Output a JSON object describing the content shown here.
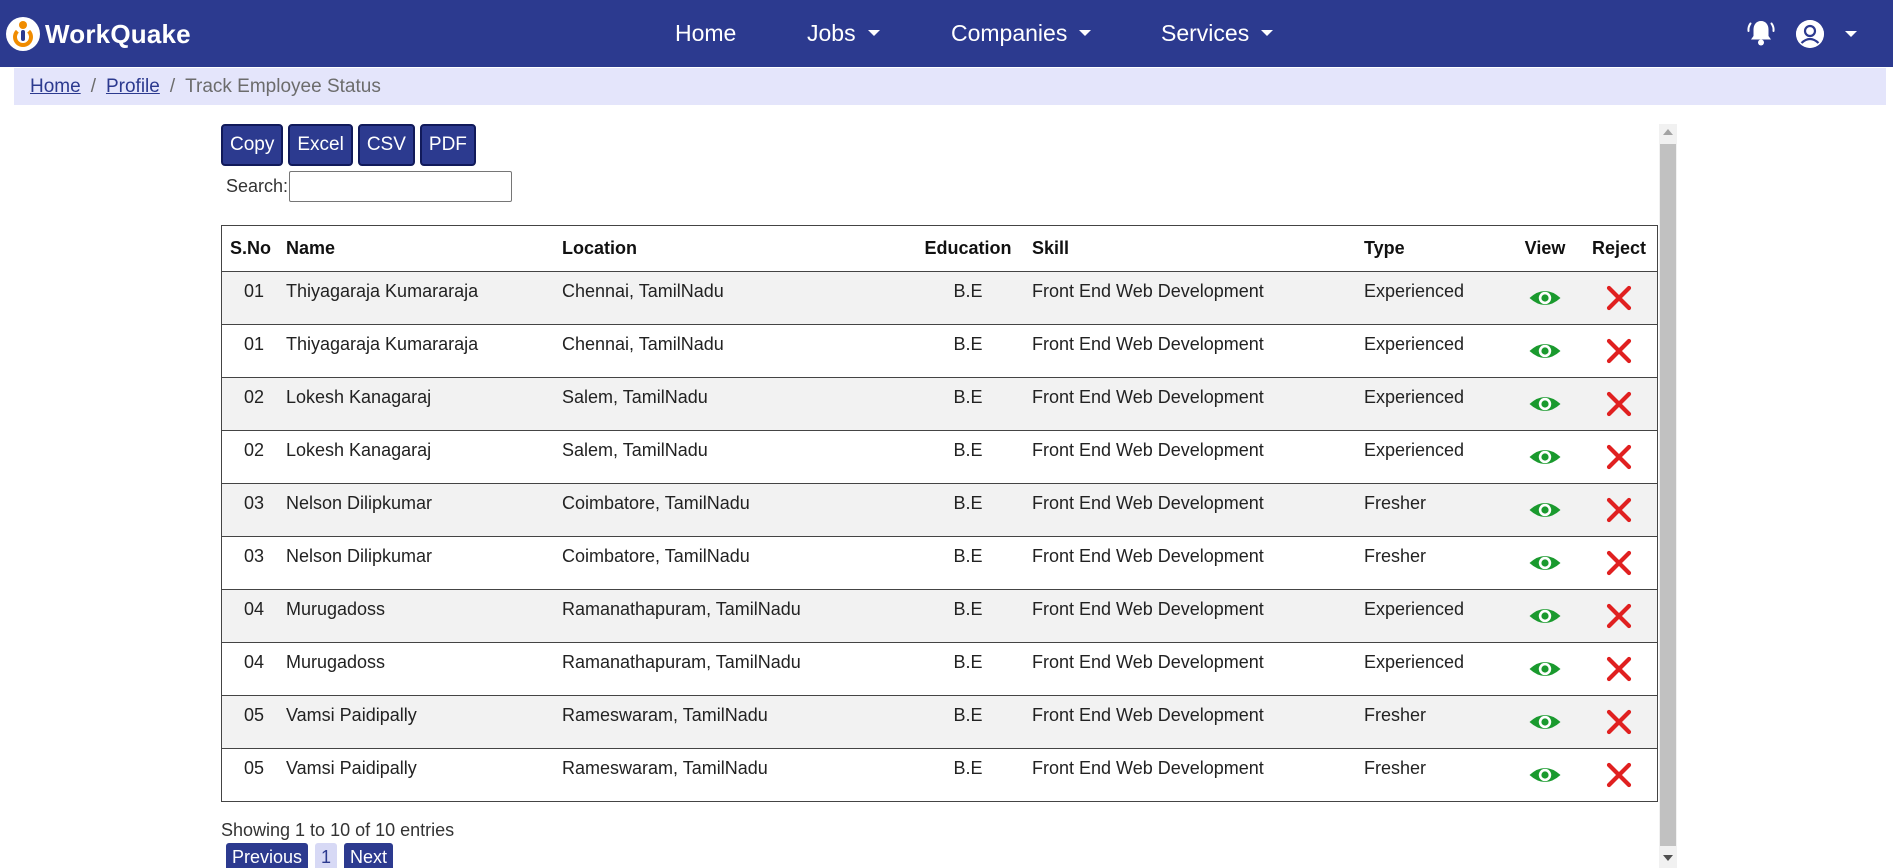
{
  "nav": {
    "brand": "WorkQuake",
    "items": [
      {
        "label": "Home"
      },
      {
        "label": "Jobs"
      },
      {
        "label": "Companies"
      },
      {
        "label": "Services"
      }
    ]
  },
  "breadcrumb": {
    "home": "Home",
    "profile": "Profile",
    "current": "Track Employee Status",
    "separator": "/"
  },
  "toolbar": {
    "copy": "Copy",
    "excel": "Excel",
    "csv": "CSV",
    "pdf": "PDF"
  },
  "search": {
    "label": "Search:",
    "value": ""
  },
  "table": {
    "headers": {
      "sno": "S.No",
      "name": "Name",
      "location": "Location",
      "education": "Education",
      "skill": "Skill",
      "type": "Type",
      "view": "View",
      "reject": "Reject"
    },
    "rows": [
      {
        "sno": "01",
        "name": "Thiyagaraja Kumararaja",
        "location": "Chennai, TamilNadu",
        "education": "B.E",
        "skill": "Front End Web Development",
        "type": "Experienced"
      },
      {
        "sno": "01",
        "name": "Thiyagaraja Kumararaja",
        "location": "Chennai, TamilNadu",
        "education": "B.E",
        "skill": "Front End Web Development",
        "type": "Experienced"
      },
      {
        "sno": "02",
        "name": "Lokesh Kanagaraj",
        "location": "Salem, TamilNadu",
        "education": "B.E",
        "skill": "Front End Web Development",
        "type": "Experienced"
      },
      {
        "sno": "02",
        "name": "Lokesh Kanagaraj",
        "location": "Salem, TamilNadu",
        "education": "B.E",
        "skill": "Front End Web Development",
        "type": "Experienced"
      },
      {
        "sno": "03",
        "name": "Nelson Dilipkumar",
        "location": "Coimbatore, TamilNadu",
        "education": "B.E",
        "skill": "Front End Web Development",
        "type": "Fresher"
      },
      {
        "sno": "03",
        "name": "Nelson Dilipkumar",
        "location": "Coimbatore, TamilNadu",
        "education": "B.E",
        "skill": "Front End Web Development",
        "type": "Fresher"
      },
      {
        "sno": "04",
        "name": "Murugadoss",
        "location": "Ramanathapuram, TamilNadu",
        "education": "B.E",
        "skill": "Front End Web Development",
        "type": "Experienced"
      },
      {
        "sno": "04",
        "name": "Murugadoss",
        "location": "Ramanathapuram, TamilNadu",
        "education": "B.E",
        "skill": "Front End Web Development",
        "type": "Experienced"
      },
      {
        "sno": "05",
        "name": "Vamsi Paidipally",
        "location": "Rameswaram, TamilNadu",
        "education": "B.E",
        "skill": "Front End Web Development",
        "type": "Fresher"
      },
      {
        "sno": "05",
        "name": "Vamsi Paidipally",
        "location": "Rameswaram, TamilNadu",
        "education": "B.E",
        "skill": "Front End Web Development",
        "type": "Fresher"
      }
    ]
  },
  "info": "Showing 1 to 10 of 10 entries",
  "pagination": {
    "previous": "Previous",
    "page": "1",
    "next": "Next"
  },
  "colors": {
    "brand": "#2c3a8f",
    "breadcrumb_bg": "#e4e5fb",
    "view_icon": "#1a9a2e",
    "reject_icon": "#e02020"
  },
  "icons": {
    "view": "eye-icon",
    "reject": "x-icon",
    "notifications": "bell-icon",
    "account": "user-icon"
  }
}
